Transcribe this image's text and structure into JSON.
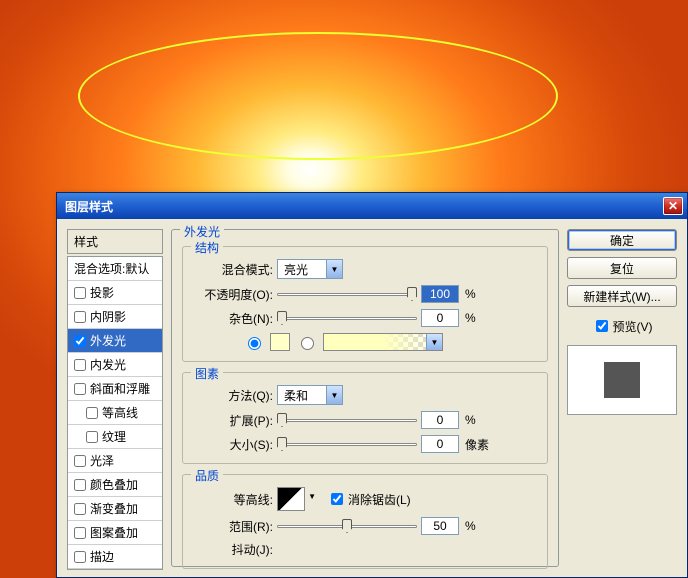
{
  "dialog": {
    "title": "图层样式",
    "styles_header": "样式",
    "styles": [
      {
        "label": "混合选项:默认",
        "checked": null
      },
      {
        "label": "投影",
        "checked": false
      },
      {
        "label": "内阴影",
        "checked": false
      },
      {
        "label": "外发光",
        "checked": true,
        "active": true
      },
      {
        "label": "内发光",
        "checked": false
      },
      {
        "label": "斜面和浮雕",
        "checked": false
      },
      {
        "label": "等高线",
        "checked": false,
        "indent": true
      },
      {
        "label": "纹理",
        "checked": false,
        "indent": true
      },
      {
        "label": "光泽",
        "checked": false
      },
      {
        "label": "颜色叠加",
        "checked": false
      },
      {
        "label": "渐变叠加",
        "checked": false
      },
      {
        "label": "图案叠加",
        "checked": false
      },
      {
        "label": "描边",
        "checked": false
      }
    ],
    "panel_title": "外发光",
    "structure": {
      "title": "结构",
      "blend_label": "混合模式:",
      "blend_value": "亮光",
      "opacity_label": "不透明度(O):",
      "opacity_value": "100",
      "opacity_unit": "%",
      "noise_label": "杂色(N):",
      "noise_value": "0",
      "noise_unit": "%"
    },
    "elements": {
      "title": "图素",
      "technique_label": "方法(Q):",
      "technique_value": "柔和",
      "spread_label": "扩展(P):",
      "spread_value": "0",
      "spread_unit": "%",
      "size_label": "大小(S):",
      "size_value": "0",
      "size_unit": "像素"
    },
    "quality": {
      "title": "品质",
      "contour_label": "等高线:",
      "antialias_label": "消除锯齿(L)",
      "range_label": "范围(R):",
      "range_value": "50",
      "range_unit": "%",
      "jitter_label": "抖动(J):"
    },
    "buttons": {
      "ok": "确定",
      "cancel": "复位",
      "new": "新建样式(W)...",
      "preview": "预览(V)"
    }
  }
}
